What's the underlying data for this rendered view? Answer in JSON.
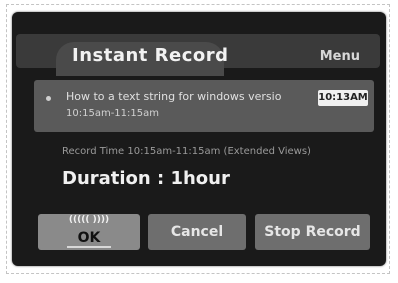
{
  "dialog": {
    "title": "Instant Record",
    "menu_label": "Menu"
  },
  "program": {
    "title": "How to a text string for windows versio",
    "time_range": "10:15am-11:15am",
    "clock": "10:13AM"
  },
  "record_time": "Record Time 10:15am-11:15am (Extended Views)",
  "duration": "Duration : 1hour",
  "buttons": {
    "ok_sub": "((((( ))))",
    "ok": "OK",
    "cancel": "Cancel",
    "stop": "Stop Record"
  }
}
